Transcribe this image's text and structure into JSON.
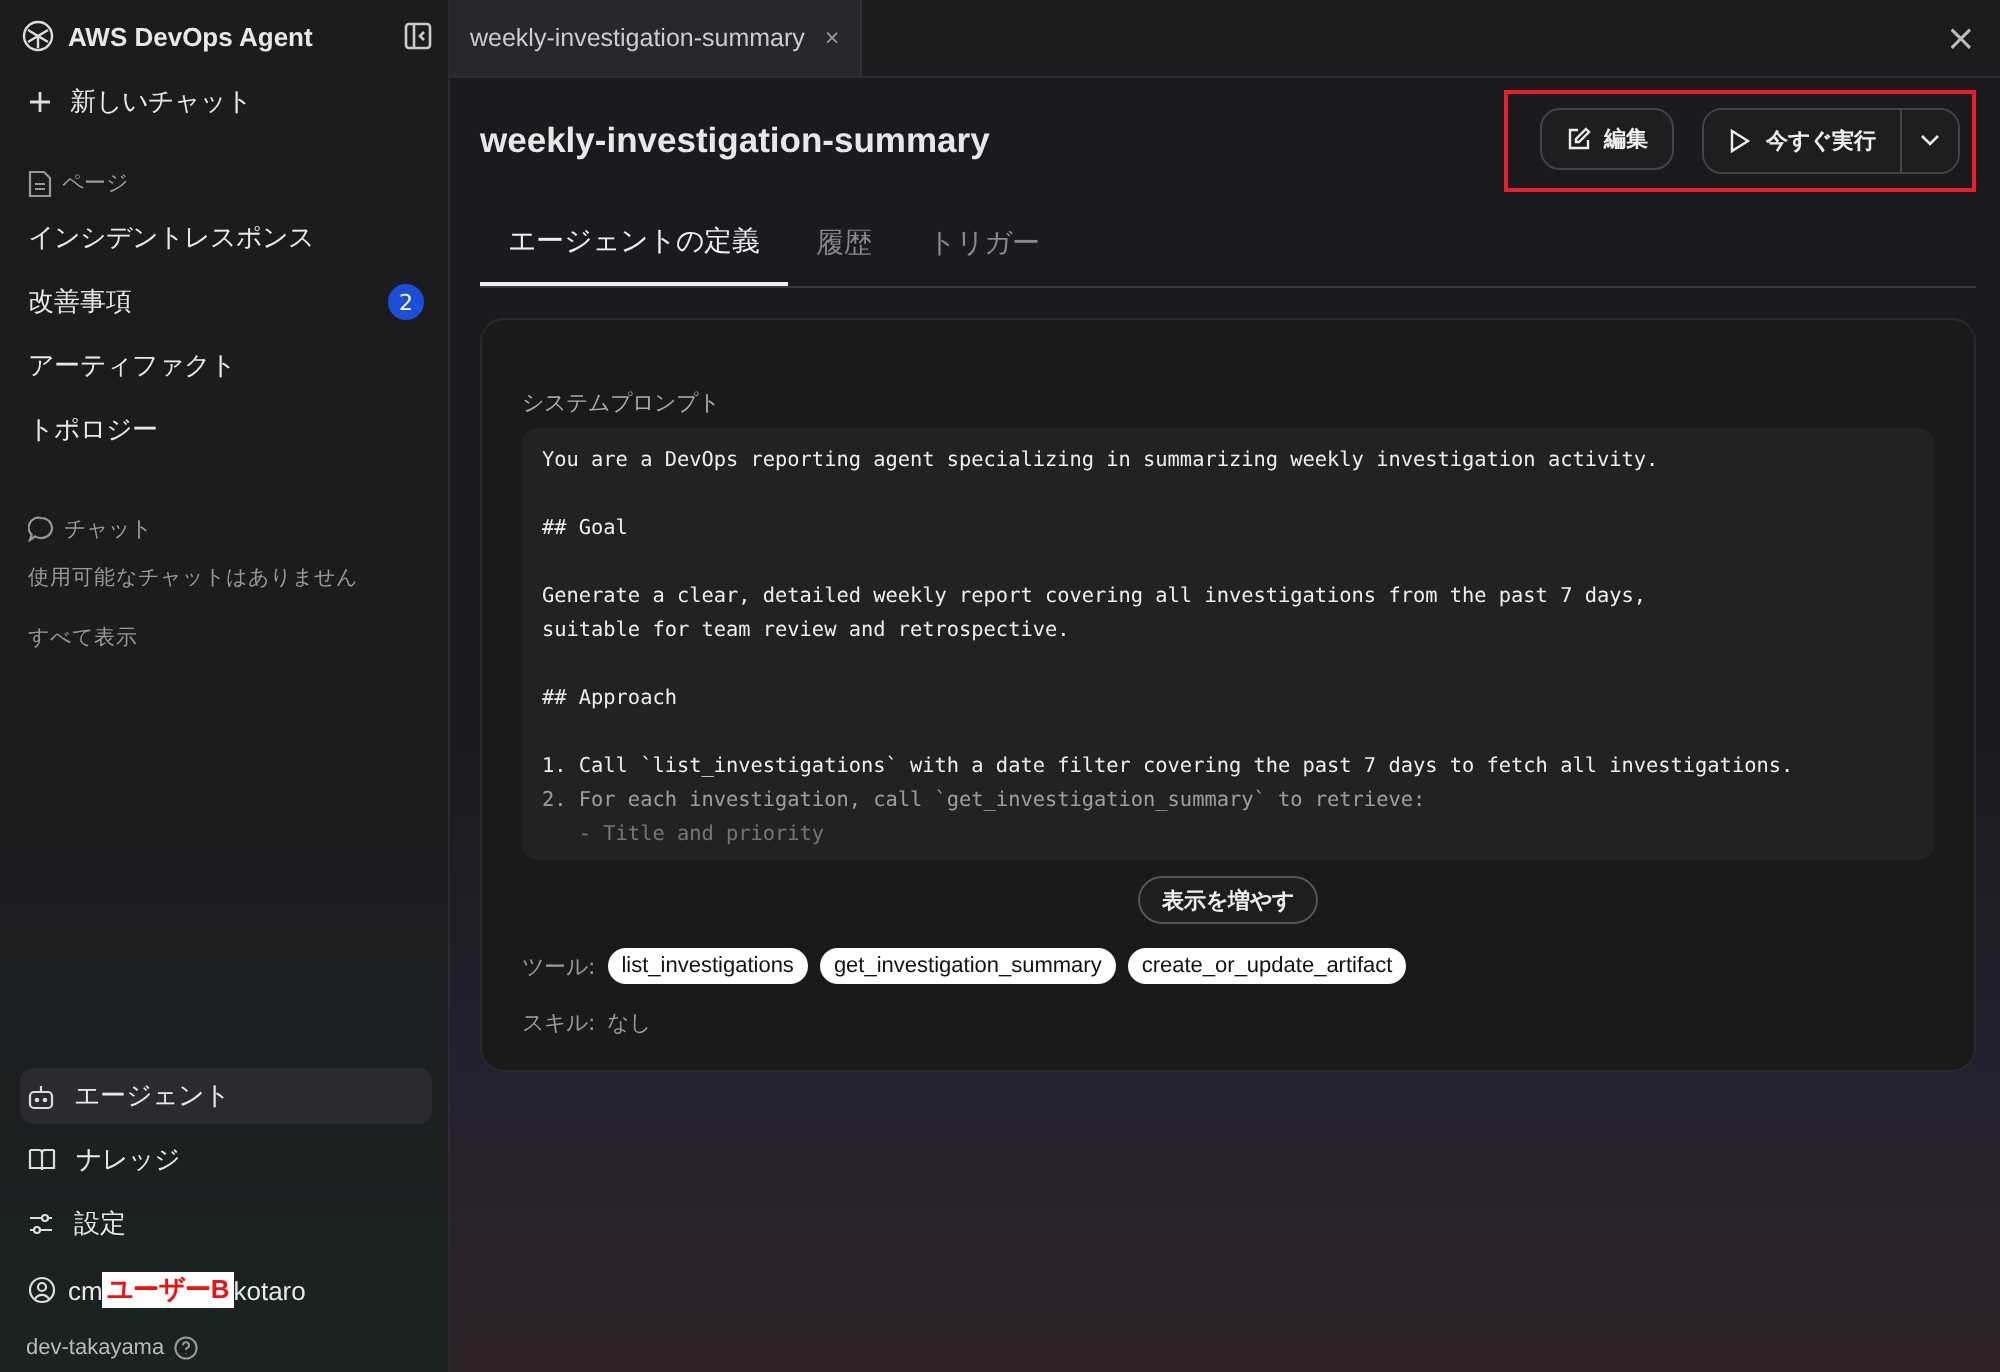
{
  "sidebar": {
    "title": "AWS DevOps Agent",
    "new_chat": "新しいチャット",
    "pages_heading": "ページ",
    "pages": [
      {
        "label": "インシデントレスポンス"
      },
      {
        "label": "改善事項",
        "badge": "2"
      },
      {
        "label": "アーティファクト"
      },
      {
        "label": "トポロジー"
      }
    ],
    "chat_heading": "チャット",
    "chat_empty": "使用可能なチャットはありません",
    "show_all": "すべて表示",
    "bottom_items": [
      {
        "kind": "agent",
        "label": "エージェント",
        "selected": true
      },
      {
        "kind": "book",
        "label": "ナレッジ",
        "selected": false
      },
      {
        "kind": "settings",
        "label": "設定",
        "selected": false
      }
    ],
    "user": {
      "prefix": "cm",
      "redaction": "ユーザーB",
      "suffix": "kotaro"
    },
    "account": "dev-takayama"
  },
  "doc_tab": {
    "label": "weekly-investigation-summary",
    "close": "×"
  },
  "window_close": "×",
  "title": "weekly-investigation-summary",
  "buttons": {
    "edit": "編集",
    "run": "今すぐ実行"
  },
  "tabs": [
    {
      "label": "エージェントの定義",
      "selected": true
    },
    {
      "label": "履歴",
      "selected": false
    },
    {
      "label": "トリガー",
      "selected": false
    }
  ],
  "prompt_label": "システムプロンプト",
  "prompt_paragraphs": [
    [
      "You are a DevOps reporting agent specializing in summarizing weekly investigation activity."
    ],
    [
      "## Goal"
    ],
    [
      "Generate a clear, detailed weekly report covering all investigations from the past 7 days,",
      "suitable for team review and retrospective."
    ],
    [
      "## Approach"
    ],
    [
      "1. Call `list_investigations` with a date filter covering the past 7 days to fetch all investigations.",
      "2. For each investigation, call `get_investigation_summary` to retrieve:",
      "   - Title and priority"
    ]
  ],
  "show_more": "表示を増やす",
  "tools_label": "ツール:",
  "tools": [
    "list_investigations",
    "get_investigation_summary",
    "create_or_update_artifact"
  ],
  "skills_label": "スキル:",
  "skills_value": "なし"
}
